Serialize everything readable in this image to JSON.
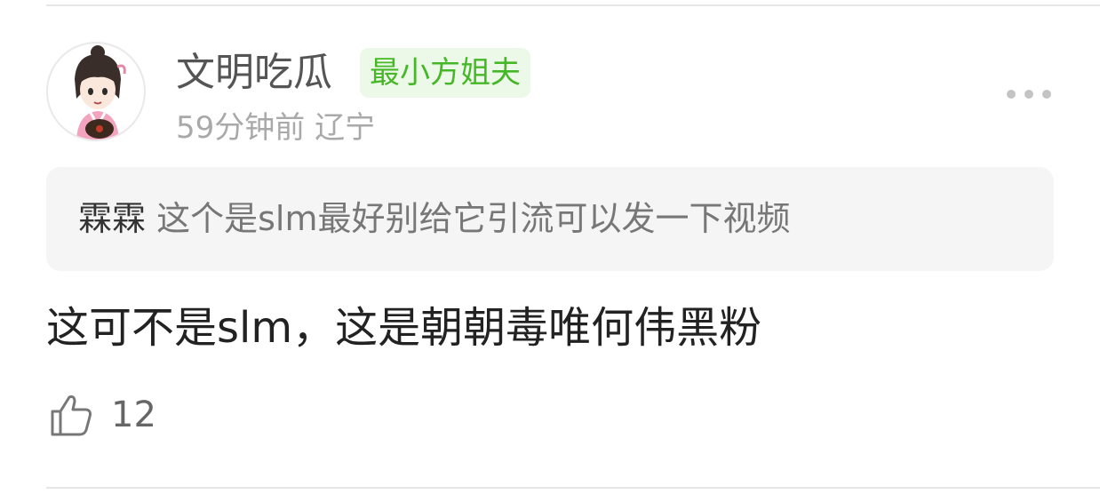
{
  "comment": {
    "user": {
      "name": "文明吃瓜",
      "badge": "最小方姐夫",
      "avatar_icon": "cartoon-girl-avatar"
    },
    "meta": "59分钟前 辽宁",
    "quote": {
      "author": "霖霖",
      "text": "这个是slm最好别给它引流可以发一下视频"
    },
    "text": "这可不是slm，这是朝朝毒唯何伟黑粉",
    "likes": "12",
    "icons": {
      "more": "more-dots-icon",
      "like": "thumbs-up-icon"
    },
    "colors": {
      "badge_text": "#46b828",
      "badge_bg": "#ecf8e8",
      "quote_bg": "#f5f5f5"
    }
  }
}
